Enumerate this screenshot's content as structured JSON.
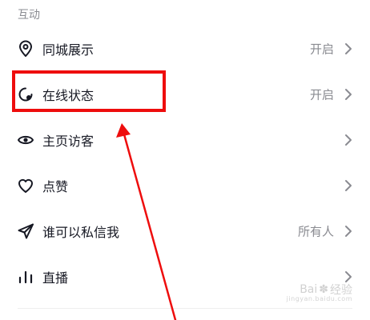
{
  "section": {
    "title": "互动"
  },
  "rows": [
    {
      "label": "同城展示",
      "value": "开启",
      "icon": "location-pin-icon"
    },
    {
      "label": "在线状态",
      "value": "开启",
      "icon": "online-status-icon"
    },
    {
      "label": "主页访客",
      "value": "",
      "icon": "eye-icon"
    },
    {
      "label": "点赞",
      "value": "",
      "icon": "heart-icon"
    },
    {
      "label": "谁可以私信我",
      "value": "所有人",
      "icon": "paper-plane-icon"
    },
    {
      "label": "直播",
      "value": "",
      "icon": "bar-chart-icon"
    }
  ],
  "annotation": {
    "highlight_color": "#ee0d0d",
    "arrow_color": "#ee0d0d"
  },
  "watermark": {
    "brand": "Bai",
    "suffix": "经验",
    "sub": "jingyan.baidu.com"
  },
  "colors": {
    "primary_text": "#161823",
    "secondary_text": "#8a8b91",
    "background": "#ffffff"
  }
}
